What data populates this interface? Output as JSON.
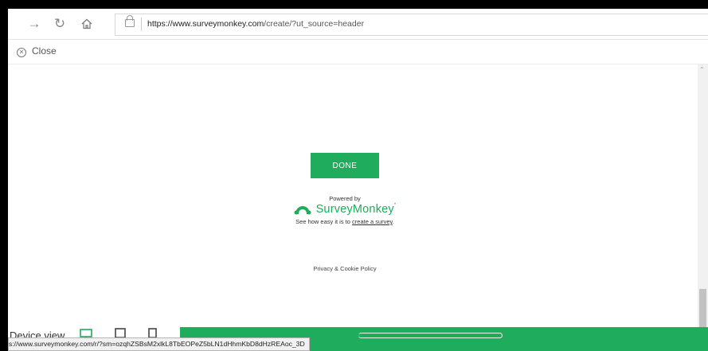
{
  "browser": {
    "url_host": "https://www.surveymonkey.com",
    "url_path": "/create/?ut_source=header",
    "status_url": "s://www.surveymonkey.com/r/?sm=ozqhZSBsM2xlkL8TbEOPeZ5bLN1dHhmKbD8dHzREAoc_3D"
  },
  "closebar": {
    "label": "Close"
  },
  "content": {
    "done_label": "DONE",
    "powered_by": "Powered by",
    "brand_name": "SurveyMonkey",
    "brand_tm": "*",
    "see_how_prefix": "See how easy it is to ",
    "see_how_link": "create a survey",
    "see_how_suffix": ".",
    "privacy": "Privacy & Cookie Policy"
  },
  "device": {
    "label": "Device view",
    "selected": "desktop"
  },
  "colors": {
    "accent": "#1fac5c",
    "icon_gray": "#888888"
  },
  "icons": [
    "forward-arrow-icon",
    "refresh-icon",
    "home-icon",
    "lock-icon",
    "close-circle-icon",
    "desktop-icon",
    "tablet-icon",
    "mobile-icon"
  ]
}
